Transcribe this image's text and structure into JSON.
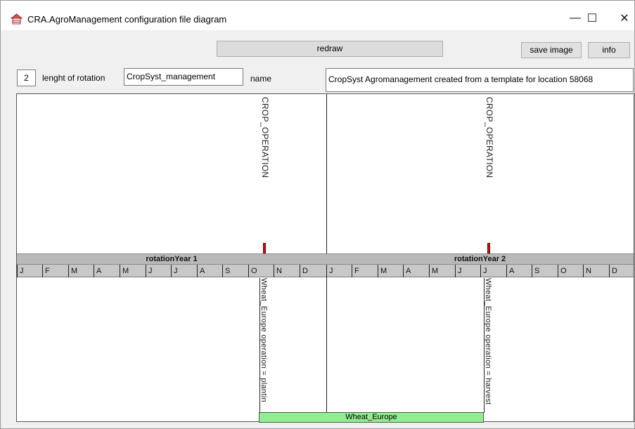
{
  "window": {
    "title": "CRA.AgroManagement configuration file diagram",
    "minimize_glyph": "—",
    "maximize_glyph": "☐",
    "close_glyph": "✕"
  },
  "toolbar": {
    "redraw_label": "redraw",
    "save_image_label": "save image",
    "info_label": "info"
  },
  "settings": {
    "rotation_length_value": "2",
    "rotation_length_label": "lenght of rotation",
    "name_value": "CropSyst_management",
    "name_label": "name",
    "description_value": "CropSyst Agromanagement created from a template for location 58068"
  },
  "diagram": {
    "years": [
      {
        "label": "rotationYear 1"
      },
      {
        "label": "rotationYear 2"
      }
    ],
    "months": [
      "J",
      "F",
      "M",
      "A",
      "M",
      "J",
      "J",
      "A",
      "S",
      "O",
      "N",
      "D"
    ],
    "operation_headers": [
      "CROP_OPERATION",
      "CROP_OPERATION"
    ],
    "operations": [
      {
        "label": "Wheat_Europe operation = plantin"
      },
      {
        "label": "Wheat_Europe operation = harvest"
      }
    ],
    "crop": {
      "label": "Wheat_Europe",
      "color": "#90ee90"
    },
    "marker_color": "#cc1111"
  }
}
